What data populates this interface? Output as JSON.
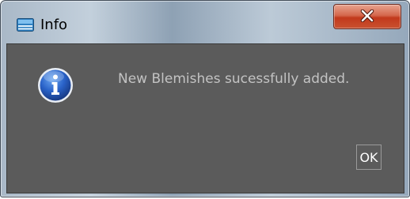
{
  "window": {
    "title": "Info",
    "close_label": "X",
    "icon": "window-app-icon"
  },
  "dialog": {
    "icon": "info-icon",
    "message": "New Blemishes sucessfully added.",
    "ok_label": "OK"
  },
  "colors": {
    "content_bg": "#5b5b5b",
    "message_text": "#c3c3c3",
    "close_button": "#c94a2e"
  }
}
